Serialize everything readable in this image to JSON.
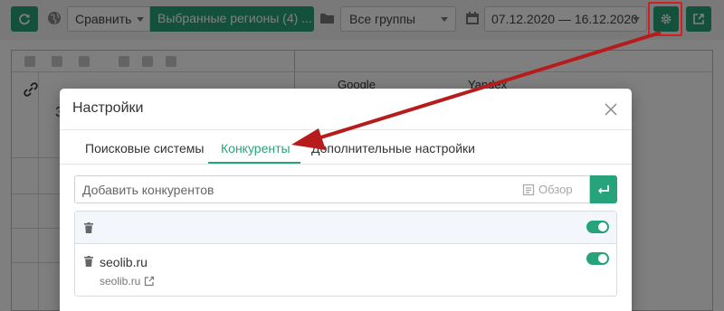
{
  "toolbar": {
    "compare_label": "Сравнить",
    "regions_label": "Выбранные регионы (4) ...",
    "groups_label": "Все группы",
    "date_range": "07.12.2020 — 16.12.2020"
  },
  "background_table": {
    "columns": [
      "Google",
      "Yandex"
    ],
    "title_initial": "З"
  },
  "modal": {
    "title": "Настройки",
    "tabs": [
      {
        "label": "Поисковые системы",
        "active": false
      },
      {
        "label": "Конкуренты",
        "active": true
      },
      {
        "label": "Дополнительные настройки",
        "active": false
      }
    ],
    "add_placeholder": "Добавить конкурентов",
    "browse_label": "Обзор",
    "competitors": [
      {
        "name": "",
        "url": "",
        "enabled": true
      },
      {
        "name": "seolib.ru",
        "url": "seolib.ru",
        "enabled": true
      }
    ]
  },
  "colors": {
    "accent": "#27a37b",
    "highlight": "#d11f1f"
  },
  "icons": [
    "refresh-icon",
    "globe-icon",
    "folder-icon",
    "calendar-icon",
    "gear-icon",
    "export-icon",
    "close-icon",
    "notepad-icon",
    "enter-icon",
    "trash-icon",
    "external-link-icon",
    "link-icon"
  ]
}
